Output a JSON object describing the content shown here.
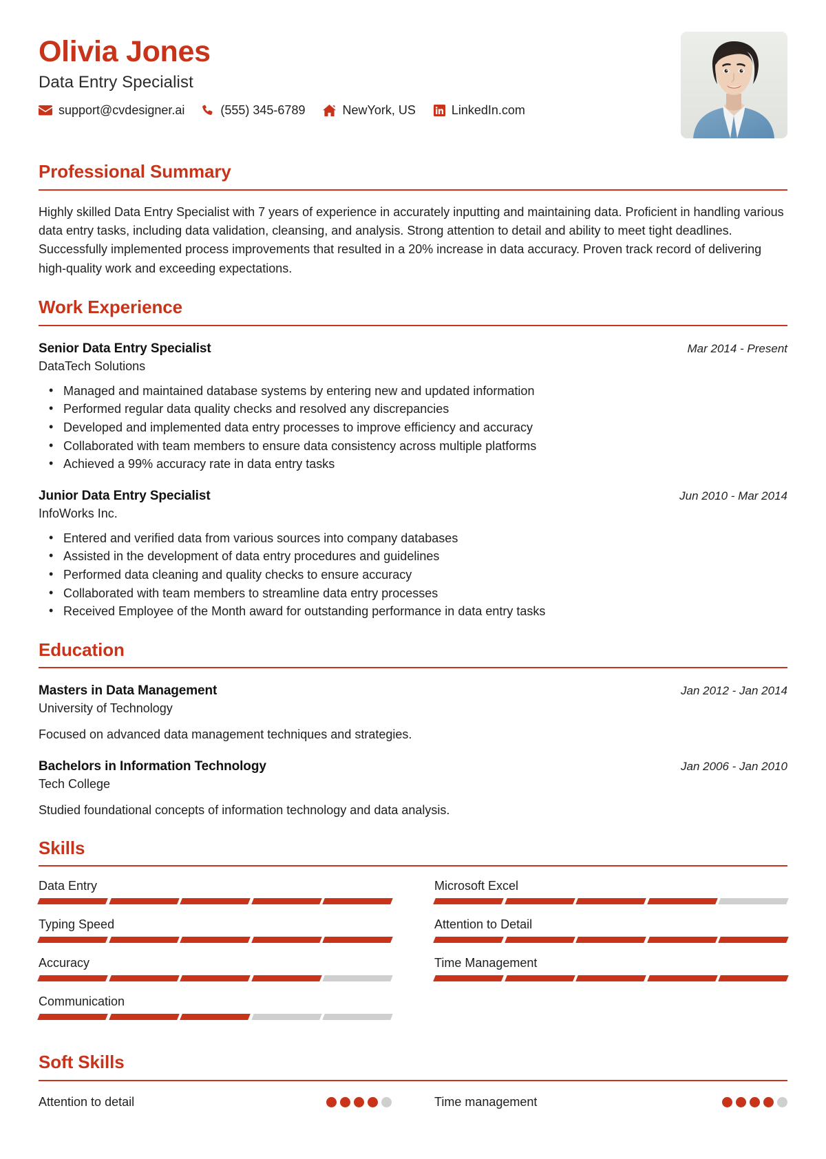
{
  "theme": {
    "accent": "#C8341A",
    "empty": "#CFCFCF",
    "text": "#1F1F1F"
  },
  "header": {
    "full_name": "Olivia Jones",
    "job_title": "Data Entry Specialist",
    "contacts": [
      {
        "icon": "envelope-icon",
        "text": "support@cvdesigner.ai"
      },
      {
        "icon": "phone-icon",
        "text": "(555) 345-6789"
      },
      {
        "icon": "home-icon",
        "text": "NewYork, US"
      },
      {
        "icon": "linkedin-icon",
        "text": "LinkedIn.com"
      }
    ],
    "photo_alt": "profile-photo"
  },
  "sections": {
    "summary": {
      "title": "Professional Summary",
      "text": "Highly skilled Data Entry Specialist with 7 years of experience in accurately inputting and maintaining data. Proficient in handling various data entry tasks, including data validation, cleansing, and analysis. Strong attention to detail and ability to meet tight deadlines. Successfully implemented process improvements that resulted in a 20% increase in data accuracy. Proven track record of delivering high-quality work and exceeding expectations."
    },
    "work": {
      "title": "Work Experience",
      "entries": [
        {
          "title": "Senior Data Entry Specialist",
          "org": "DataTech Solutions",
          "date": "Mar 2014 - Present",
          "bullets": [
            "Managed and maintained database systems by entering new and updated information",
            "Performed regular data quality checks and resolved any discrepancies",
            "Developed and implemented data entry processes to improve efficiency and accuracy",
            "Collaborated with team members to ensure data consistency across multiple platforms",
            "Achieved a 99% accuracy rate in data entry tasks"
          ]
        },
        {
          "title": "Junior Data Entry Specialist",
          "org": "InfoWorks Inc.",
          "date": "Jun 2010 - Mar 2014",
          "bullets": [
            "Entered and verified data from various sources into company databases",
            "Assisted in the development of data entry procedures and guidelines",
            "Performed data cleaning and quality checks to ensure accuracy",
            "Collaborated with team members to streamline data entry processes",
            "Received Employee of the Month award for outstanding performance in data entry tasks"
          ]
        }
      ]
    },
    "education": {
      "title": "Education",
      "entries": [
        {
          "title": "Masters in Data Management",
          "org": "University of Technology",
          "date": "Jan 2012 - Jan 2014",
          "desc": "Focused on advanced data management techniques and strategies."
        },
        {
          "title": "Bachelors in Information Technology",
          "org": "Tech College",
          "date": "Jan 2006 - Jan 2010",
          "desc": "Studied foundational concepts of information technology and data analysis."
        }
      ]
    },
    "skills": {
      "title": "Skills",
      "max_segments": 5,
      "items": [
        {
          "name": "Data Entry",
          "level": 5
        },
        {
          "name": "Microsoft Excel",
          "level": 4
        },
        {
          "name": "Typing Speed",
          "level": 5
        },
        {
          "name": "Attention to Detail",
          "level": 5
        },
        {
          "name": "Accuracy",
          "level": 4
        },
        {
          "name": "Time Management",
          "level": 5
        },
        {
          "name": "Communication",
          "level": 3
        }
      ]
    },
    "soft_skills": {
      "title": "Soft Skills",
      "max_dots": 5,
      "items": [
        {
          "name": "Attention to detail",
          "level": 4
        },
        {
          "name": "Time management",
          "level": 4
        }
      ]
    }
  }
}
